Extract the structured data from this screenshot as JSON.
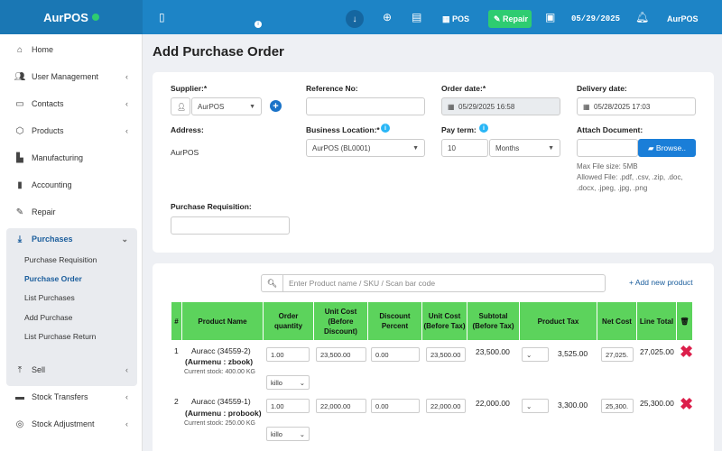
{
  "topbar": {
    "brand": "AurPOS",
    "pos_label": "POS",
    "repair_label": "Repair",
    "date": "05/29/2025",
    "user": "AurPOS"
  },
  "sidebar": {
    "items": [
      {
        "label": "Home",
        "icon": "home-icon"
      },
      {
        "label": "User Management",
        "icon": "users-icon"
      },
      {
        "label": "Contacts",
        "icon": "contacts-icon"
      },
      {
        "label": "Products",
        "icon": "box-icon"
      },
      {
        "label": "Manufacturing",
        "icon": "factory-icon"
      },
      {
        "label": "Accounting",
        "icon": "book-icon"
      },
      {
        "label": "Repair",
        "icon": "wrench-icon"
      },
      {
        "label": "Purchases",
        "icon": "download-icon"
      },
      {
        "label": "Sell",
        "icon": "upload-icon"
      },
      {
        "label": "Stock Transfers",
        "icon": "truck-icon"
      },
      {
        "label": "Stock Adjustment",
        "icon": "database-icon"
      }
    ],
    "purchases_sub": [
      "Purchase Requisition",
      "Purchase Order",
      "List Purchases",
      "Add Purchase",
      "List Purchase Return"
    ]
  },
  "page": {
    "title": "Add Purchase Order"
  },
  "form": {
    "supplier_label": "Supplier:*",
    "supplier_value": "AurPOS",
    "reference_label": "Reference No:",
    "order_date_label": "Order date:*",
    "order_date_value": "05/29/2025 16:58",
    "delivery_date_label": "Delivery date:",
    "delivery_date_value": "05/28/2025 17:03",
    "address_label": "Address:",
    "address_value": "AurPOS",
    "business_location_label": "Business Location:*",
    "business_location_value": "AurPOS (BL0001)",
    "pay_term_label": "Pay term:",
    "pay_term_value": "10",
    "pay_term_unit": "Months",
    "attach_label": "Attach Document:",
    "browse_label": "Browse..",
    "max_file": "Max File size: 5MB",
    "allowed_1": "Allowed File: .pdf, .csv, .zip, .doc,",
    "allowed_2": ".docx, .jpeg, .jpg, .png",
    "requisition_label": "Purchase Requisition:"
  },
  "table": {
    "search_placeholder": "Enter Product name / SKU / Scan bar code",
    "add_new_product": "Add new product",
    "headers": [
      "#",
      "Product Name",
      "Order quantity",
      "Unit Cost (Before Discount)",
      "Discount Percent",
      "Unit Cost (Before Tax)",
      "Subtotal (Before Tax)",
      "Product Tax",
      "Net Cost",
      "Line Total"
    ],
    "rows": [
      {
        "num": "1",
        "name_1": "Auracc (34559-2)",
        "name_2": "(Aurmenu : zbook)",
        "stock": "Current stock: 400.00 KG",
        "qty": "1.00",
        "unit": "killo",
        "unit_cost": "23,500.00",
        "discount": "0.00",
        "unit_cost_bt": "23,500.00",
        "subtotal": "23,500.00",
        "tax": "3,525.00",
        "net_cost": "27,025.",
        "line_total": "27,025.00"
      },
      {
        "num": "2",
        "name_1": "Auracc (34559-1)",
        "name_2": "(Aurmenu : probook)",
        "stock": "Current stock: 250.00 KG",
        "qty": "1.00",
        "unit": "killo",
        "unit_cost": "22,000.00",
        "discount": "0.00",
        "unit_cost_bt": "22,000.00",
        "subtotal": "22,000.00",
        "tax": "3,300.00",
        "net_cost": "25,300.",
        "line_total": "25,300.00"
      }
    ]
  },
  "colors": {
    "topbar": "#1d84c6",
    "table_header": "#5cd35c",
    "delete": "#dc1f4b",
    "accent": "#1a7ed8"
  }
}
